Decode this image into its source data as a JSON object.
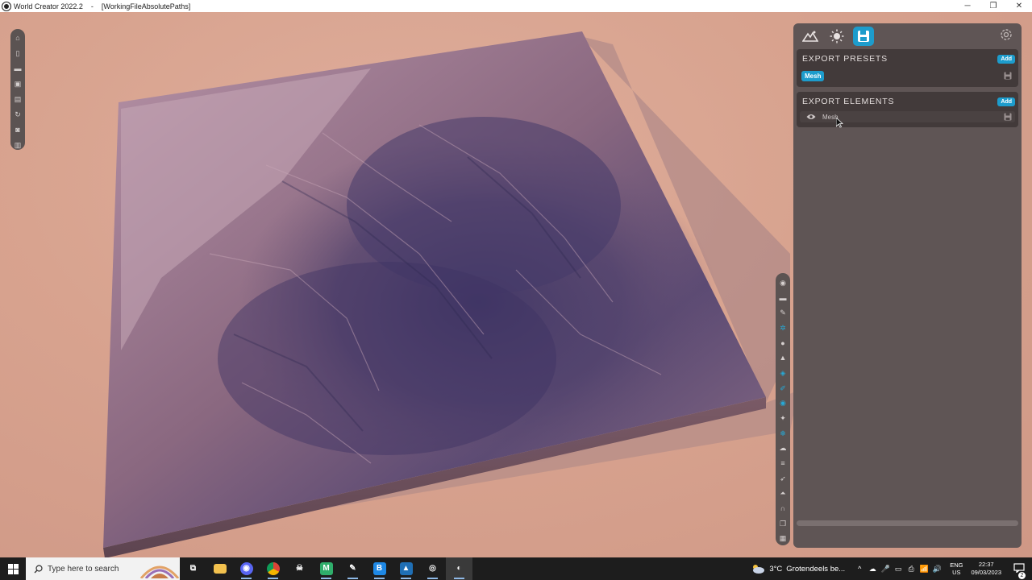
{
  "window": {
    "app_title": "World Creator 2022.2",
    "separator": "-",
    "document_title": "[WorkingFileAbsolutePaths]",
    "controls": [
      "─",
      "❐",
      "✕"
    ]
  },
  "left_toolbar": {
    "icons": [
      "home-icon",
      "new-file-icon",
      "open-folder-icon",
      "save-icon",
      "save-as-icon",
      "refresh-icon",
      "camera-icon",
      "export-icon"
    ]
  },
  "right_strip": {
    "icons": [
      "target-icon",
      "folder-icon",
      "brush-icon",
      "gear-node-icon",
      "drop-icon",
      "mountain-icon",
      "layers-icon",
      "paint-icon",
      "eye-icon",
      "sparkle-icon",
      "snowflake-icon",
      "cloud-icon",
      "lines-icon",
      "rocket-icon",
      "terrain-icon",
      "arch-icon",
      "copy-icon",
      "chart-icon"
    ],
    "active_index": [
      3,
      6,
      7,
      8,
      10
    ],
    "active_color": "#27a9d6"
  },
  "panel": {
    "tabs": [
      {
        "icon": "landscape-icon",
        "active": false
      },
      {
        "icon": "sun-icon",
        "active": false
      },
      {
        "icon": "floppy-icon",
        "active": true
      }
    ],
    "accent": "#1d9ccc",
    "export_presets": {
      "title": "EXPORT PRESETS",
      "add_label": "Add",
      "items": [
        {
          "label": "Mesh"
        }
      ]
    },
    "export_elements": {
      "title": "EXPORT ELEMENTS",
      "add_label": "Add",
      "items": [
        {
          "label": "Mesh",
          "visible": true
        }
      ]
    }
  },
  "taskbar": {
    "search_placeholder": "Type here to search",
    "apps": [
      {
        "name": "task-view",
        "glyph": "⧉",
        "color": "transparent"
      },
      {
        "name": "file-explorer",
        "glyph": "",
        "color": "#f2c14e"
      },
      {
        "name": "discord",
        "glyph": "◉",
        "color": "#5865f2"
      },
      {
        "name": "chrome",
        "glyph": "●",
        "color": "#db4437"
      },
      {
        "name": "app-skull",
        "glyph": "☠",
        "color": "transparent"
      },
      {
        "name": "app-m",
        "glyph": "M",
        "color": "#2fae6b"
      },
      {
        "name": "app-gimp",
        "glyph": "✎",
        "color": "transparent"
      },
      {
        "name": "app-b",
        "glyph": "B",
        "color": "#1e88e5"
      },
      {
        "name": "app-photos",
        "glyph": "▲",
        "color": "#1f6fb5"
      },
      {
        "name": "app-recorder",
        "glyph": "◎",
        "color": "transparent"
      },
      {
        "name": "world-creator",
        "glyph": "◐",
        "color": "transparent"
      }
    ],
    "weather": {
      "temp": "3°C",
      "desc": "Grotendeels be..."
    },
    "tray_icons": [
      "^",
      "☁",
      "🎤",
      "▭",
      "⎙",
      "📶",
      "🔊"
    ],
    "language": {
      "lang": "ENG",
      "region": "US"
    },
    "clock": {
      "time": "22:37",
      "date": "09/03/2023"
    },
    "notifications": "2"
  }
}
